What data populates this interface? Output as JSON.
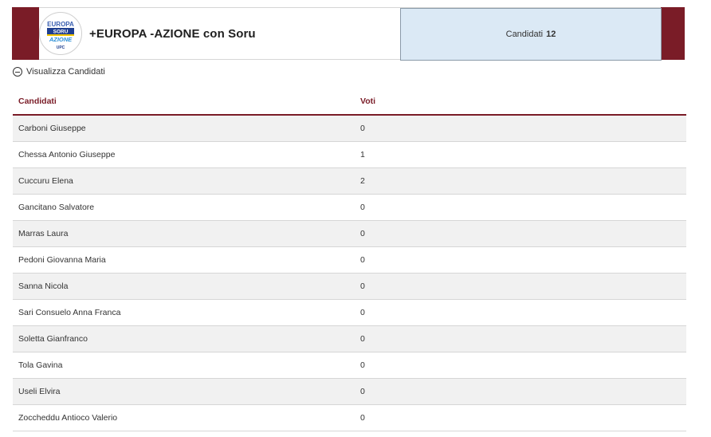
{
  "party": {
    "name": "+EUROPA -AZIONE con Soru",
    "logo": {
      "line1": "EUROPA",
      "line2": "SORU",
      "line3": "AZIONE",
      "line4": "UPC"
    },
    "candidates_label": "Candidati",
    "candidates_count": "12"
  },
  "toggle": {
    "label": "Visualizza Candidati",
    "icon": "minus-circle-icon"
  },
  "table": {
    "headers": [
      "Candidati",
      "Voti"
    ],
    "rows": [
      {
        "name": "Carboni Giuseppe",
        "votes": "0"
      },
      {
        "name": "Chessa Antonio Giuseppe",
        "votes": "1"
      },
      {
        "name": "Cuccuru Elena",
        "votes": "2"
      },
      {
        "name": "Gancitano Salvatore",
        "votes": "0"
      },
      {
        "name": "Marras Laura",
        "votes": "0"
      },
      {
        "name": "Pedoni Giovanna Maria",
        "votes": "0"
      },
      {
        "name": "Sanna Nicola",
        "votes": "0"
      },
      {
        "name": "Sari Consuelo Anna Franca",
        "votes": "0"
      },
      {
        "name": "Soletta Gianfranco",
        "votes": "0"
      },
      {
        "name": "Tola Gavina",
        "votes": "0"
      },
      {
        "name": "Useli Elvira",
        "votes": "0"
      },
      {
        "name": "Zoccheddu Antioco Valerio",
        "votes": "0"
      }
    ]
  },
  "colors": {
    "accent": "#7a1c27",
    "box_bg": "#dbe9f5",
    "row_alt": "#f1f1f1"
  }
}
